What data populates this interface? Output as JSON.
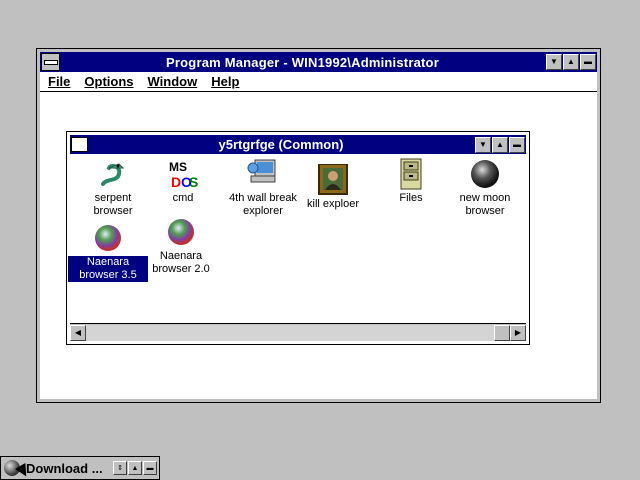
{
  "program_manager": {
    "title": "Program Manager - WIN1992\\Administrator",
    "menu": [
      "File",
      "Options",
      "Window",
      "Help"
    ]
  },
  "group_window": {
    "title": "y5rtgrfge (Common)",
    "icons": [
      {
        "label": "serpent browser",
        "icon": "serpent-icon",
        "selected": false
      },
      {
        "label": "cmd",
        "icon": "msdos-icon",
        "selected": false
      },
      {
        "label": "4th wall break explorer",
        "icon": "computer-icon",
        "selected": false
      },
      {
        "label": "kill exploer",
        "icon": "portrait-icon",
        "selected": false
      },
      {
        "label": "Files",
        "icon": "file-cabinet-icon",
        "selected": false
      },
      {
        "label": "new moon browser",
        "icon": "moon-icon",
        "selected": false
      },
      {
        "label": "Naenara browser 3.5",
        "icon": "globe-icon",
        "selected": true
      },
      {
        "label": "Naenara browser 2.0",
        "icon": "globe-icon",
        "selected": false
      }
    ]
  },
  "minimized_window": {
    "title": "Download ..."
  },
  "colors": {
    "title_active": "#000080",
    "background": "#c0c0c0",
    "client": "#ffffff"
  }
}
